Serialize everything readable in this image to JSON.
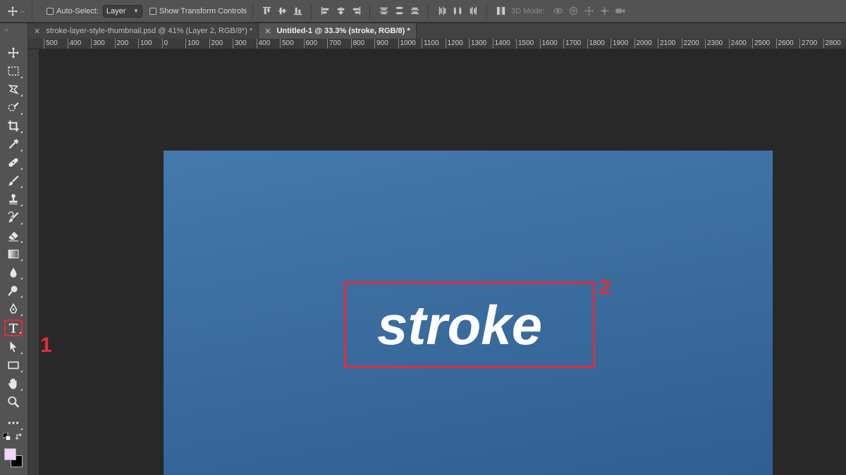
{
  "options_bar": {
    "auto_select_label": "Auto-Select:",
    "auto_select_value": "Layer",
    "show_transform_label": "Show Transform Controls",
    "mode_3d_label": "3D Mode:"
  },
  "tabs": [
    {
      "label": "stroke-layer-style-thumbnail.psd @ 41% (Layer 2, RGB/8*) *",
      "active": false
    },
    {
      "label": "Untitled-1 @ 33.3% (stroke, RGB/8) *",
      "active": true
    }
  ],
  "ruler_ticks": [
    "500",
    "400",
    "300",
    "200",
    "100",
    "0",
    "100",
    "200",
    "300",
    "400",
    "500",
    "600",
    "700",
    "800",
    "900",
    "1000",
    "1100",
    "1200",
    "1300",
    "1400",
    "1500",
    "1600",
    "1700",
    "1800",
    "1900",
    "2000",
    "2100",
    "2200",
    "2300",
    "2400",
    "2500",
    "2600",
    "2700",
    "2800"
  ],
  "canvas": {
    "text": "stroke",
    "background_color": "#3b6d9f",
    "text_color": "#ffffff"
  },
  "colors": {
    "foreground": "#efd6f5",
    "background": "#000000",
    "annotation": "#e32c38"
  },
  "annotations": {
    "label_1": "1",
    "label_2": "2"
  }
}
